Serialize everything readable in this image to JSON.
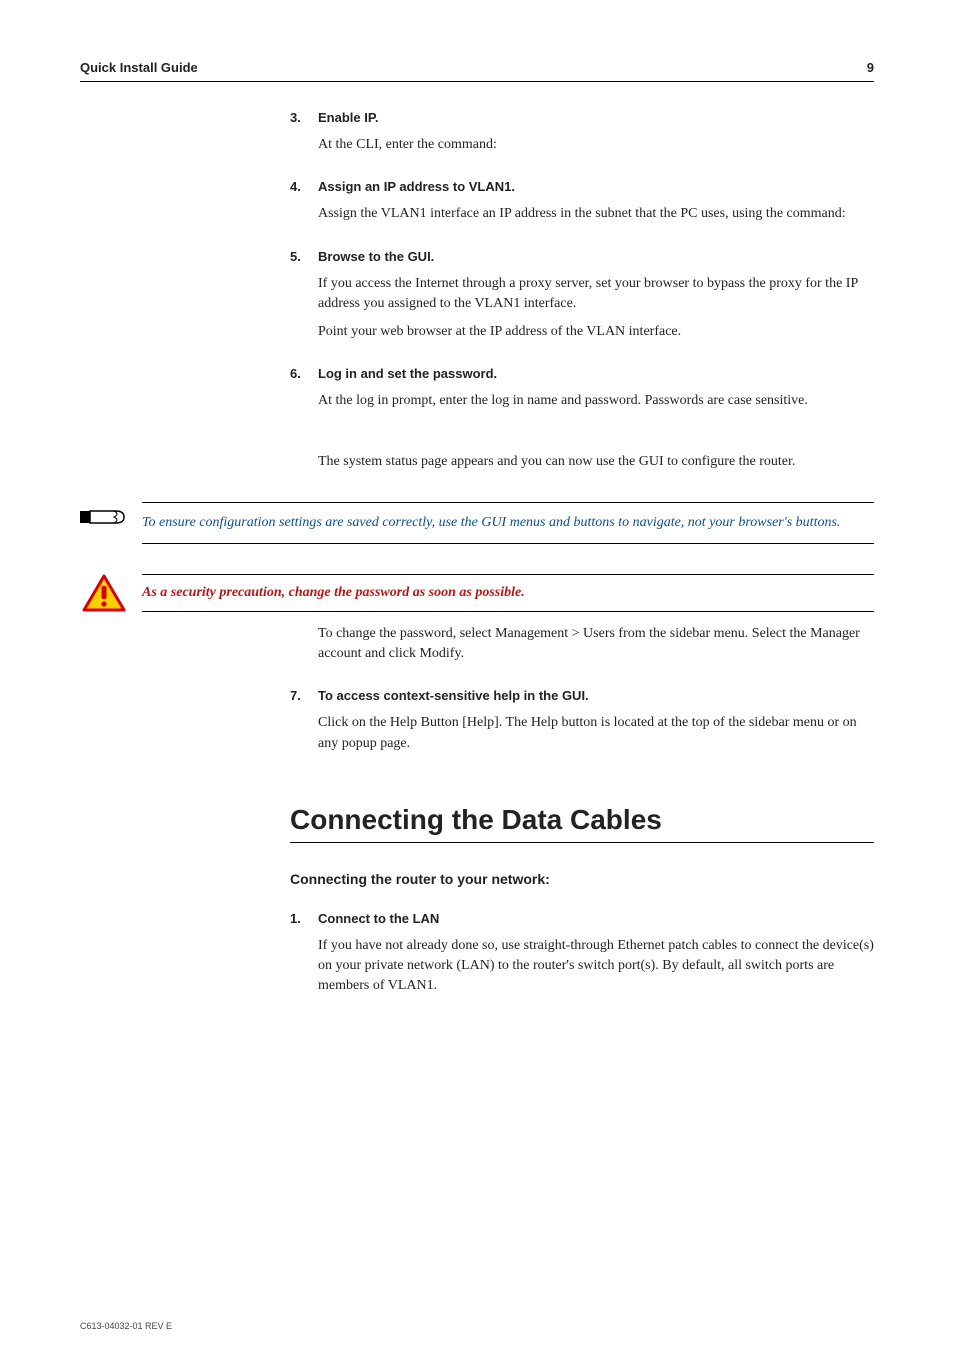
{
  "header": {
    "title": "Quick Install Guide",
    "page": "9"
  },
  "steps": {
    "s3": {
      "num": "3.",
      "title": "Enable IP.",
      "p1": "At the CLI, enter the command:"
    },
    "s4": {
      "num": "4.",
      "title": "Assign an IP address to VLAN1.",
      "p1": "Assign the VLAN1 interface an IP address in the subnet that the PC uses, using the command:"
    },
    "s5": {
      "num": "5.",
      "title": "Browse to the GUI.",
      "p1": "If you access the Internet through a proxy server, set your browser to bypass the proxy for the IP address you assigned to the VLAN1 interface.",
      "p2": "Point your web browser at the IP address of the VLAN interface."
    },
    "s6": {
      "num": "6.",
      "title": "Log in and set the password.",
      "p1": "At the log in prompt, enter the log in name and password. Passwords are case sensitive.",
      "p2": "The system status page appears and you can now use the GUI to configure the router."
    },
    "s7": {
      "num": "7.",
      "title": "To access context-sensitive help in the GUI.",
      "p1": "Click on the Help Button [Help]. The Help button is located at the top of the sidebar menu or on any popup page."
    }
  },
  "note": "To ensure configuration settings are saved correctly, use the GUI menus and buttons to navigate, not your browser's buttons.",
  "warning": "As a security precaution, change the password as soon as possible.",
  "warning_followup": "To change the password, select Management > Users from the sidebar menu. Select the Manager account and click Modify.",
  "section": {
    "title": "Connecting the Data Cables",
    "subhead": "Connecting the router to your network:",
    "step1": {
      "num": "1.",
      "title": "Connect to the LAN",
      "p1": "If you have not already done so, use straight-through Ethernet patch cables to connect the device(s) on your private network (LAN) to the router's switch port(s). By default, all switch ports are members of VLAN1."
    }
  },
  "footer": "C613-04032-01 REV E"
}
